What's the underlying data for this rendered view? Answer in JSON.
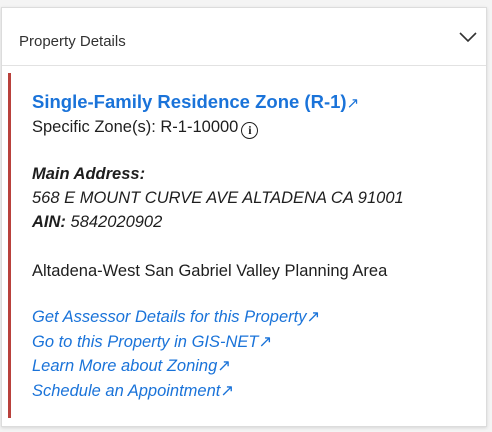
{
  "panel": {
    "title": "Property Details",
    "toggle_icon": "chevron-down-icon"
  },
  "zone": {
    "name": "Single-Family Residence Zone (R-1)",
    "external_glyph": "↗",
    "specific_label": "Specific Zone(s):",
    "specific_value": "R-1-10000",
    "info_glyph": "i"
  },
  "address": {
    "label": "Main Address:",
    "value": "568 E MOUNT CURVE AVE ALTADENA CA 91001",
    "ain_label": "AIN:",
    "ain_value": "5842020902"
  },
  "planning_area": "Altadena-West San Gabriel Valley Planning Area",
  "links": [
    {
      "label": "Get Assessor Details for this Property",
      "glyph": "↗"
    },
    {
      "label": "Go to this Property in GIS-NET",
      "glyph": "↗"
    },
    {
      "label": "Learn More about Zoning",
      "glyph": "↗"
    },
    {
      "label": "Schedule an Appointment",
      "glyph": "↗"
    }
  ],
  "colors": {
    "accent_bar": "#b9413c",
    "link": "#1a73d9",
    "text": "#1e1e1e"
  }
}
